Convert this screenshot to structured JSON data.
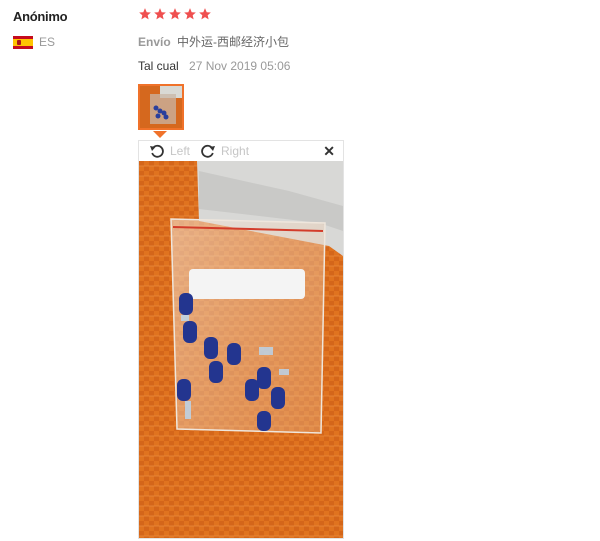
{
  "reviewer": {
    "name": "Anónimo",
    "country_code": "ES",
    "flag_icon": "spain-flag-icon"
  },
  "review": {
    "rating": 5,
    "rating_max": 5,
    "star_color": "#ef4f4f",
    "shipping_label": "Envío",
    "shipping_value": "中外运-西邮经济小包",
    "attribute": "Tal cual",
    "date": "27 Nov 2019 05:06"
  },
  "viewer": {
    "rotate_left_label": "Left",
    "rotate_right_label": "Right",
    "rotate_left_icon": "rotate-left-icon",
    "rotate_right_icon": "rotate-right-icon",
    "close_icon": "close-icon",
    "photo_description_icon": "photo-image",
    "accent_color": "#f0722a"
  }
}
